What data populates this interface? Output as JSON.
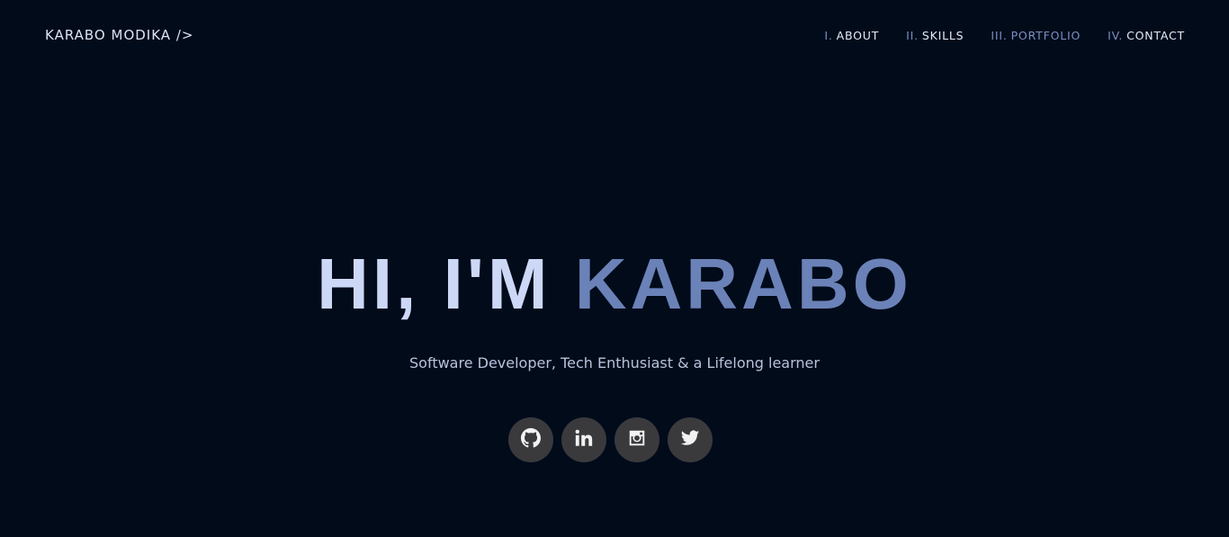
{
  "brand": "KARABO MODIKA />",
  "nav": [
    {
      "num": "I.",
      "label": "ABOUT"
    },
    {
      "num": "II.",
      "label": "SKILLS"
    },
    {
      "num": "III.",
      "label": "PORTFOLIO"
    },
    {
      "num": "IV.",
      "label": "CONTACT"
    }
  ],
  "hero": {
    "greeting": "HI, I'M ",
    "name": "KARABO",
    "subtitle": "Software Developer, Tech Enthusiast & a Lifelong learner"
  },
  "socials": [
    {
      "icon": "github-icon"
    },
    {
      "icon": "linkedin-icon"
    },
    {
      "icon": "instagram-icon"
    },
    {
      "icon": "twitter-icon"
    }
  ],
  "colors": {
    "background": "#020b1a",
    "accent": "#6b82b8",
    "title_light": "#cdd8f7",
    "social_bg": "#3a3a3d"
  }
}
